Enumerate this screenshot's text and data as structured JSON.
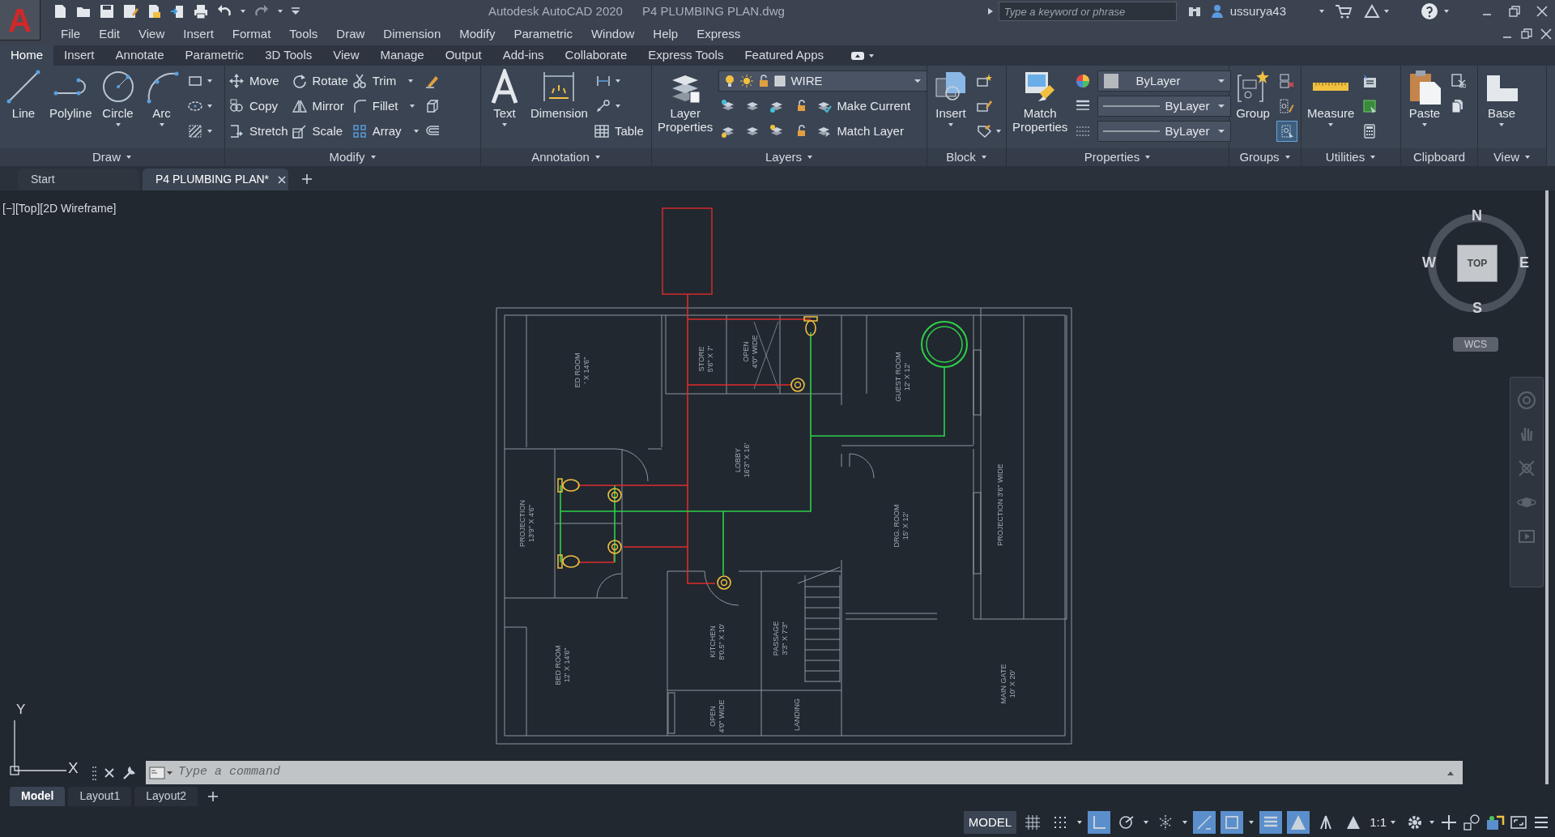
{
  "app": {
    "logo": "A",
    "title": "Autodesk AutoCAD 2020",
    "file": "P4 PLUMBING PLAN.dwg",
    "search_placeholder": "Type a keyword or phrase",
    "user": "ussurya43"
  },
  "menu": [
    "File",
    "Edit",
    "View",
    "Insert",
    "Format",
    "Tools",
    "Draw",
    "Dimension",
    "Modify",
    "Parametric",
    "Window",
    "Help",
    "Express"
  ],
  "ribbon_tabs": [
    {
      "label": "Home",
      "selected": true
    },
    {
      "label": "Insert",
      "selected": false
    },
    {
      "label": "Annotate",
      "selected": false
    },
    {
      "label": "Parametric",
      "selected": false
    },
    {
      "label": "3D Tools",
      "selected": false
    },
    {
      "label": "View",
      "selected": false
    },
    {
      "label": "Manage",
      "selected": false
    },
    {
      "label": "Output",
      "selected": false
    },
    {
      "label": "Add-ins",
      "selected": false
    },
    {
      "label": "Collaborate",
      "selected": false
    },
    {
      "label": "Express Tools",
      "selected": false
    },
    {
      "label": "Featured Apps",
      "selected": false
    }
  ],
  "panels": [
    {
      "title": "Draw",
      "columns": [
        [
          [
            {
              "kind": "large",
              "label": "Line"
            }
          ]
        ],
        [
          [
            {
              "kind": "large",
              "label": "Polyline"
            }
          ]
        ],
        [
          [
            {
              "kind": "large",
              "label": "Circle",
              "menu": true
            }
          ]
        ],
        [
          [
            {
              "kind": "large",
              "label": "Arc",
              "menu": true
            }
          ]
        ],
        [
          [
            {
              "kind": "icon",
              "menu": true
            }
          ],
          [
            {
              "kind": "icon",
              "menu": true
            }
          ],
          [
            {
              "kind": "icon",
              "menu": true
            }
          ]
        ]
      ]
    },
    {
      "title": "Modify",
      "columns": [
        [
          [
            {
              "kind": "small",
              "label": "Move"
            }
          ],
          [
            {
              "kind": "small",
              "label": "Copy"
            }
          ],
          [
            {
              "kind": "small",
              "label": "Stretch"
            }
          ]
        ],
        [
          [
            {
              "kind": "small",
              "label": "Rotate"
            }
          ],
          [
            {
              "kind": "small",
              "label": "Mirror"
            }
          ],
          [
            {
              "kind": "small",
              "label": "Scale"
            }
          ]
        ],
        [
          [
            {
              "kind": "small",
              "label": "Trim",
              "menu": true
            }
          ],
          [
            {
              "kind": "small",
              "label": "Fillet",
              "menu": true
            }
          ],
          [
            {
              "kind": "small",
              "label": "Array",
              "menu": true
            }
          ]
        ],
        [
          [
            {
              "kind": "icon"
            }
          ],
          [
            {
              "kind": "icon"
            }
          ],
          [
            {
              "kind": "icon"
            }
          ]
        ]
      ]
    },
    {
      "title": "Annotation",
      "columns": [
        [
          [
            {
              "kind": "large",
              "label": "Text",
              "menu": true
            }
          ]
        ],
        [
          [
            {
              "kind": "large",
              "label": "Dimension"
            }
          ]
        ],
        [
          [
            {
              "kind": "icon",
              "menu": true
            }
          ],
          [
            {
              "kind": "icon",
              "menu": true
            }
          ],
          [
            {
              "kind": "small",
              "label": "Table"
            }
          ]
        ]
      ]
    },
    {
      "title": "Layers",
      "columns": [
        [
          [
            {
              "kind": "large",
              "label": "Layer Properties"
            }
          ]
        ],
        [
          [
            {
              "kind": "layer_combo",
              "value": "WIRE"
            }
          ],
          [
            {
              "kind": "icon"
            },
            {
              "kind": "icon"
            },
            {
              "kind": "icon"
            },
            {
              "kind": "icon"
            },
            {
              "kind": "small",
              "label": "Make Current"
            }
          ],
          [
            {
              "kind": "icon"
            },
            {
              "kind": "icon"
            },
            {
              "kind": "icon"
            },
            {
              "kind": "icon"
            },
            {
              "kind": "small",
              "label": "Match Layer"
            }
          ]
        ]
      ]
    },
    {
      "title": "Block",
      "columns": [
        [
          [
            {
              "kind": "large",
              "label": "Insert",
              "menu": true
            }
          ]
        ],
        [
          [
            {
              "kind": "icon"
            }
          ],
          [
            {
              "kind": "icon"
            }
          ],
          [
            {
              "kind": "icon",
              "menu": true
            }
          ]
        ]
      ]
    },
    {
      "title": "Properties",
      "columns": [
        [
          [
            {
              "kind": "large",
              "label": "Match Properties"
            }
          ]
        ],
        [
          [
            {
              "kind": "icon"
            },
            {
              "kind": "swatch_combo",
              "value": "ByLayer"
            }
          ],
          [
            {
              "kind": "icon"
            },
            {
              "kind": "line_combo",
              "value": "ByLayer"
            }
          ],
          [
            {
              "kind": "icon"
            },
            {
              "kind": "line_combo",
              "value": "ByLayer"
            }
          ]
        ]
      ]
    },
    {
      "title": "Groups",
      "columns": [
        [
          [
            {
              "kind": "large",
              "label": "Group"
            }
          ]
        ],
        [
          [
            {
              "kind": "icon"
            }
          ],
          [
            {
              "kind": "icon"
            }
          ],
          [
            {
              "kind": "toggle",
              "on": true
            }
          ]
        ]
      ]
    },
    {
      "title": "Utilities",
      "columns": [
        [
          [
            {
              "kind": "large",
              "label": "Measure",
              "menu": true
            }
          ]
        ],
        [
          [
            {
              "kind": "icon"
            }
          ],
          [
            {
              "kind": "icon"
            }
          ],
          [
            {
              "kind": "icon"
            }
          ]
        ]
      ]
    },
    {
      "title": "Clipboard",
      "columns": [
        [
          [
            {
              "kind": "large",
              "label": "Paste",
              "menu": true
            }
          ]
        ],
        [
          [
            {
              "kind": "icon"
            }
          ],
          [
            {
              "kind": "icon"
            }
          ]
        ]
      ]
    },
    {
      "title": "View",
      "columns": [
        [
          [
            {
              "kind": "large",
              "label": "Base",
              "menu": true
            }
          ]
        ]
      ]
    }
  ],
  "doc_tabs": [
    {
      "label": "Start",
      "selected": false
    },
    {
      "label": "P4 PLUMBING PLAN*",
      "selected": true
    }
  ],
  "viewport": {
    "label": "[−][Top][2D Wireframe]",
    "viewcube": {
      "north": "N",
      "south": "S",
      "west": "W",
      "east": "E",
      "face": "TOP",
      "ucs": "WCS"
    },
    "ucs_axes": {
      "x": "X",
      "y": "Y"
    }
  },
  "plan": {
    "rooms": [
      {
        "lines": [
          "ED ROOM",
          "' X 14'6\""
        ]
      },
      {
        "lines": [
          "STORE",
          "5'6\" X 7'"
        ]
      },
      {
        "lines": [
          "OPEN",
          "4'0\" WIDE"
        ]
      },
      {
        "lines": [
          "GUEST ROOM",
          "12' X 12'"
        ]
      },
      {
        "lines": [
          "LOBBY",
          "16'3\" X 16'"
        ]
      },
      {
        "lines": [
          "PROJECTION",
          "13'9\" X 4'6\""
        ]
      },
      {
        "lines": [
          "DRG. ROOM",
          "15' X 12'"
        ]
      },
      {
        "lines": [
          "PROJECTION 3'6\" WIDE"
        ]
      },
      {
        "lines": [
          "BED ROOM",
          "12' X 14'6\""
        ]
      },
      {
        "lines": [
          "KITCHEN",
          "8'0.5\" X 10'"
        ]
      },
      {
        "lines": [
          "PASSAGE",
          "3'3\" X 7'3\""
        ]
      },
      {
        "lines": [
          "OPEN",
          "4'0\" WIDE"
        ]
      },
      {
        "lines": [
          "LANDING"
        ]
      },
      {
        "lines": [
          "MAIN GATE",
          "10' X 20'"
        ]
      }
    ]
  },
  "command_line": {
    "placeholder": "Type a command"
  },
  "layout_tabs": [
    {
      "label": "Model",
      "selected": true
    },
    {
      "label": "Layout1",
      "selected": false
    },
    {
      "label": "Layout2",
      "selected": false
    }
  ],
  "status_bar": {
    "mode": "MODEL",
    "toggles": [
      {
        "on": false
      },
      {
        "on": false
      },
      {
        "on": true
      },
      {
        "on": false
      },
      {
        "on": false
      },
      {
        "on": true
      },
      {
        "on": true
      },
      {
        "on": true
      },
      {
        "on": true
      },
      {
        "on": false
      },
      {
        "on": false
      }
    ],
    "scale": "1:1"
  }
}
